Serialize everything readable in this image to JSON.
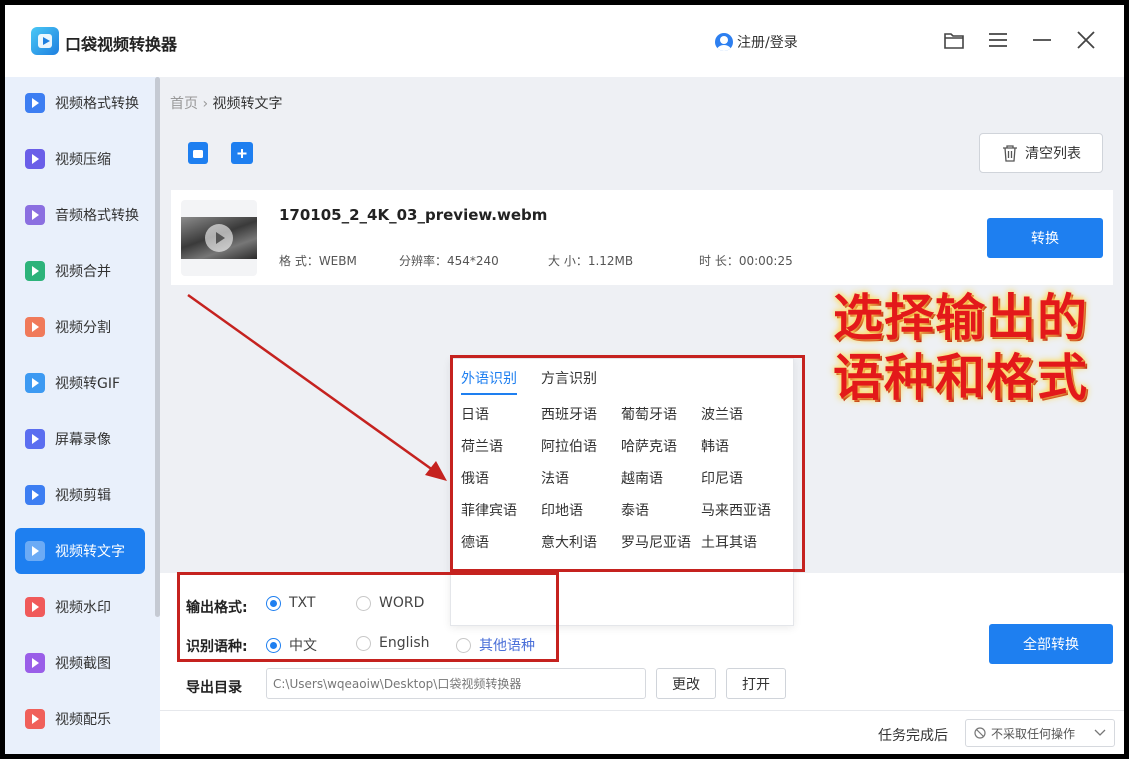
{
  "app": {
    "title": "口袋视频转换器",
    "login": "注册/登录"
  },
  "window_controls": [
    "folder-icon",
    "menu-icon",
    "minimize-icon",
    "close-icon"
  ],
  "sidebar": {
    "items": [
      {
        "label": "视频格式转换",
        "color": "#3d7ef2"
      },
      {
        "label": "视频压缩",
        "color": "#6a5ee8"
      },
      {
        "label": "音频格式转换",
        "color": "#8b6fe0"
      },
      {
        "label": "视频合并",
        "color": "#2db37a"
      },
      {
        "label": "视频分割",
        "color": "#f07a5a"
      },
      {
        "label": "视频转GIF",
        "color": "#3d9af2"
      },
      {
        "label": "屏幕录像",
        "color": "#5b6ef0"
      },
      {
        "label": "视频剪辑",
        "color": "#3d7ef2"
      },
      {
        "label": "视频转文字",
        "color": "#ffffff"
      },
      {
        "label": "视频水印",
        "color": "#f05a5a"
      },
      {
        "label": "视频截图",
        "color": "#9a5ee8"
      },
      {
        "label": "视频配乐",
        "color": "#f0605a"
      }
    ],
    "active_index": 8
  },
  "breadcrumb": {
    "home": "首页",
    "separator": "›",
    "current": "视频转文字"
  },
  "toolbar": {
    "clear_label": "清空列表"
  },
  "file": {
    "name": "170105_2_4K_03_preview.webm",
    "format": "格 式：WEBM",
    "resolution": "分辨率：454*240",
    "size": "大 小：1.12MB",
    "duration": "时 长：00:00:25",
    "convert_label": "转换"
  },
  "popup": {
    "tabs": [
      "外语识别",
      "方言识别"
    ],
    "languages": [
      [
        "日语",
        "西班牙语",
        "葡萄牙语",
        "波兰语"
      ],
      [
        "荷兰语",
        "阿拉伯语",
        "哈萨克语",
        "韩语"
      ],
      [
        "俄语",
        "法语",
        "越南语",
        "印尼语"
      ],
      [
        "菲律宾语",
        "印地语",
        "泰语",
        "马来西亚语"
      ],
      [
        "德语",
        "意大利语",
        "罗马尼亚语",
        "土耳其语"
      ]
    ]
  },
  "output": {
    "format_label": "输出格式:",
    "format_options": [
      "TXT",
      "WORD"
    ],
    "format_selected": "TXT",
    "lang_label": "识别语种:",
    "lang_options": [
      "中文",
      "English",
      "其他语种"
    ],
    "lang_selected": "中文",
    "dir_label": "导出目录",
    "dir_value": "C:\\Users\\wqeaoiw\\Desktop\\口袋视频转换器",
    "change_label": "更改",
    "open_label": "打开",
    "convert_all_label": "全部转换"
  },
  "footer": {
    "after_label": "任务完成后",
    "after_value": "不采取任何操作"
  },
  "annotation": {
    "line1": "选择输出的",
    "line2": "语种和格式",
    "color": "#e3191a"
  }
}
